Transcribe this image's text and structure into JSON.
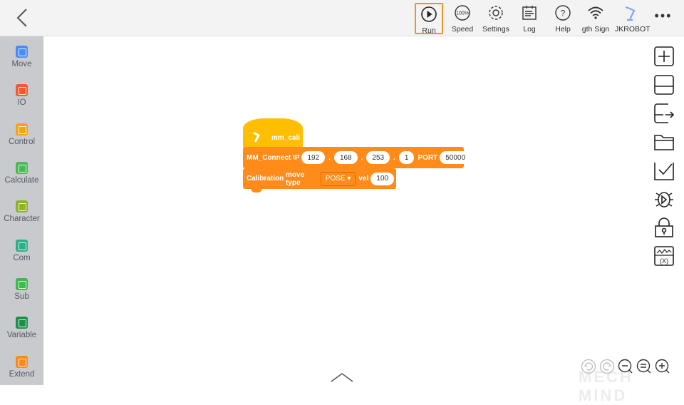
{
  "toolbar": {
    "items": [
      {
        "label": "Run",
        "icon": "play-icon"
      },
      {
        "label": "Speed",
        "icon": "speed-gauge-icon",
        "icon_text": "100%"
      },
      {
        "label": "Settings",
        "icon": "gear-icon"
      },
      {
        "label": "Log",
        "icon": "log-icon"
      },
      {
        "label": "Help",
        "icon": "help-icon"
      },
      {
        "label": "gth  Sign",
        "icon": "wifi-icon"
      },
      {
        "label": "JKROBOT",
        "icon": "robot-arm-icon"
      }
    ],
    "active": "Run",
    "accent": "#f0922b"
  },
  "sidebar": {
    "items": [
      {
        "label": "Move",
        "color": "#4a8cf7"
      },
      {
        "label": "IO",
        "color": "#f05a2e"
      },
      {
        "label": "Control",
        "color": "#f7a21b"
      },
      {
        "label": "Calculate",
        "color": "#4cb85a"
      },
      {
        "label": "Character",
        "color": "#8fb51c"
      },
      {
        "label": "Com",
        "color": "#2fae86"
      },
      {
        "label": "Sub",
        "color": "#3bbb4f"
      },
      {
        "label": "Variable",
        "color": "#1e8f4a"
      },
      {
        "label": "Extend",
        "color": "#f7891f"
      }
    ]
  },
  "blocks": {
    "hat": {
      "label": "mm_cali",
      "color": "#ffbf00"
    },
    "connect": {
      "label": "MM_Connect",
      "ip_label": "IP",
      "ip": [
        "192",
        "168",
        "253",
        "1"
      ],
      "port_label": "PORT",
      "port": "50000",
      "color": "#ff8c1a"
    },
    "calibration": {
      "label": "Calibration",
      "move_type_label": "move type",
      "move_type": "POSE",
      "vel_label": "vel",
      "vel": "100"
    }
  },
  "right_tools": [
    "add-icon",
    "save-icon",
    "save-as-icon",
    "open-folder-icon",
    "checklist-icon",
    "debug-icon",
    "lock-icon",
    "variable-watch-icon"
  ],
  "watermark": "MECH MIND"
}
